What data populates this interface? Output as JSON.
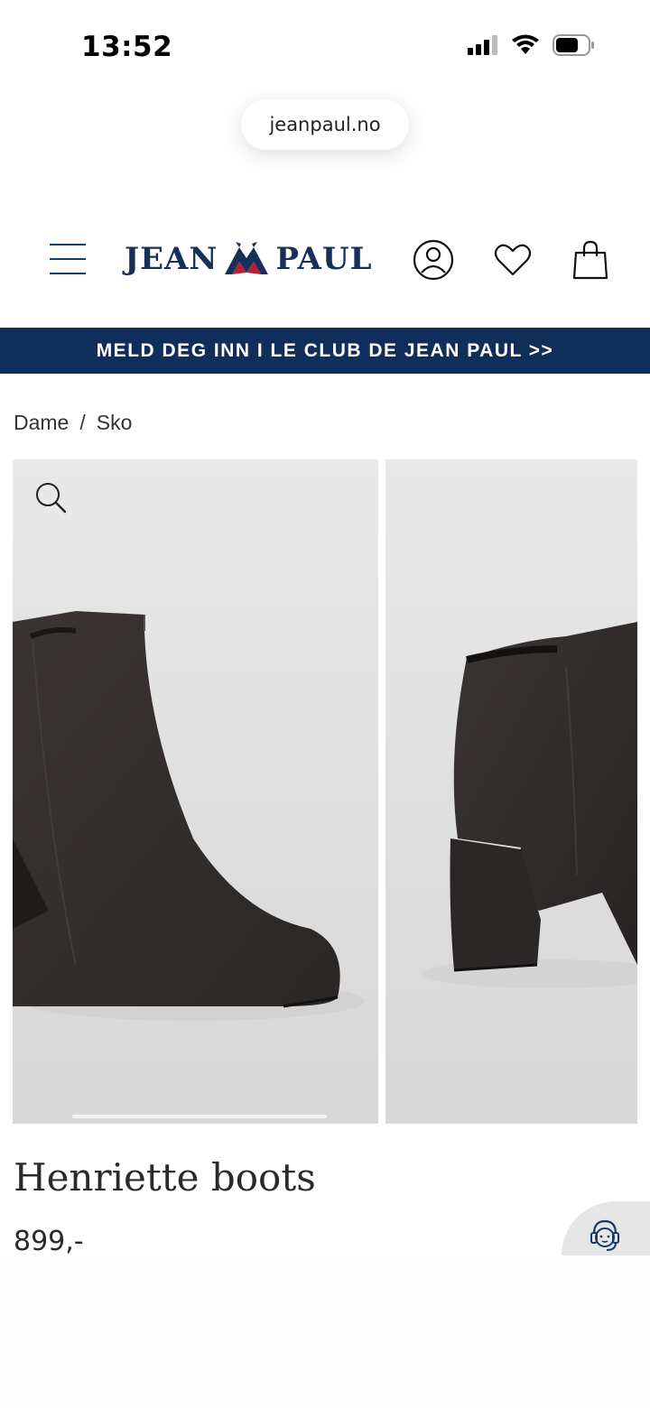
{
  "status_bar": {
    "time": "13:52"
  },
  "browser": {
    "url": "jeanpaul.no"
  },
  "header": {
    "logo_left": "JEAN",
    "logo_right": "PAUL",
    "icons": [
      "menu-icon",
      "account-icon",
      "heart-icon",
      "bag-icon"
    ]
  },
  "promo": {
    "text": "MELD DEG INN I LE CLUB DE JEAN PAUL >>"
  },
  "breadcrumb": {
    "items": [
      "Dame",
      "Sko"
    ],
    "separator": "/"
  },
  "product": {
    "title": "Henriette boots",
    "price": "899,-"
  },
  "colors": {
    "brand_navy": "#0f2f5a",
    "brand_red": "#b0223a"
  }
}
